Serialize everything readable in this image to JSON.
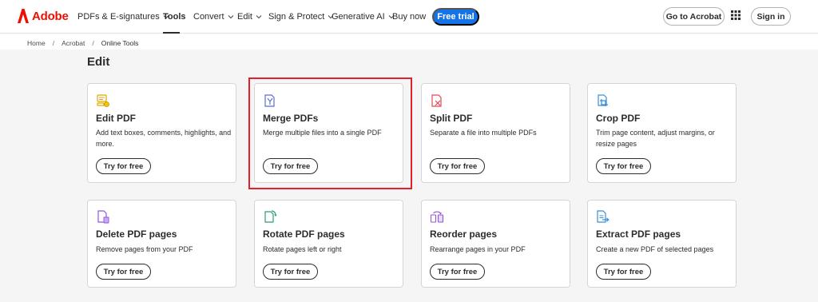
{
  "brand": {
    "name": "Adobe",
    "color": "#eb1000"
  },
  "nav": {
    "pdfs": "PDFs & E-signatures",
    "tools": "Tools",
    "convert": "Convert",
    "edit": "Edit",
    "sign": "Sign & Protect",
    "genai": "Generative AI",
    "buy": "Buy now",
    "free_trial": "Free trial",
    "go_to_acrobat": "Go to Acrobat",
    "sign_in": "Sign in"
  },
  "breadcrumb": {
    "home": "Home",
    "acrobat": "Acrobat",
    "current": "Online Tools",
    "separator": "/"
  },
  "section": {
    "title": "Edit"
  },
  "cards": [
    {
      "title": "Edit PDF",
      "desc": "Add text boxes, comments, highlights, and more.",
      "cta": "Try for free",
      "icon": "edit-pdf-icon"
    },
    {
      "title": "Merge PDFs",
      "desc": "Merge multiple files into a single PDF",
      "cta": "Try for free",
      "icon": "merge-pdfs-icon"
    },
    {
      "title": "Split PDF",
      "desc": "Separate a file into multiple PDFs",
      "cta": "Try for free",
      "icon": "split-pdf-icon"
    },
    {
      "title": "Crop PDF",
      "desc": "Trim page content, adjust margins, or resize pages",
      "cta": "Try for free",
      "icon": "crop-pdf-icon"
    },
    {
      "title": "Delete PDF pages",
      "desc": "Remove pages from your PDF",
      "cta": "Try for free",
      "icon": "delete-pages-icon"
    },
    {
      "title": "Rotate PDF pages",
      "desc": "Rotate pages left or right",
      "cta": "Try for free",
      "icon": "rotate-pages-icon"
    },
    {
      "title": "Reorder pages",
      "desc": "Rearrange pages in your PDF",
      "cta": "Try for free",
      "icon": "reorder-pages-icon"
    },
    {
      "title": "Extract PDF pages",
      "desc": "Create a new PDF of selected pages",
      "cta": "Try for free",
      "icon": "extract-pages-icon"
    }
  ],
  "colors": {
    "accent": "#1473e6",
    "highlight": "#e3202a",
    "text": "#2c2c2c"
  }
}
